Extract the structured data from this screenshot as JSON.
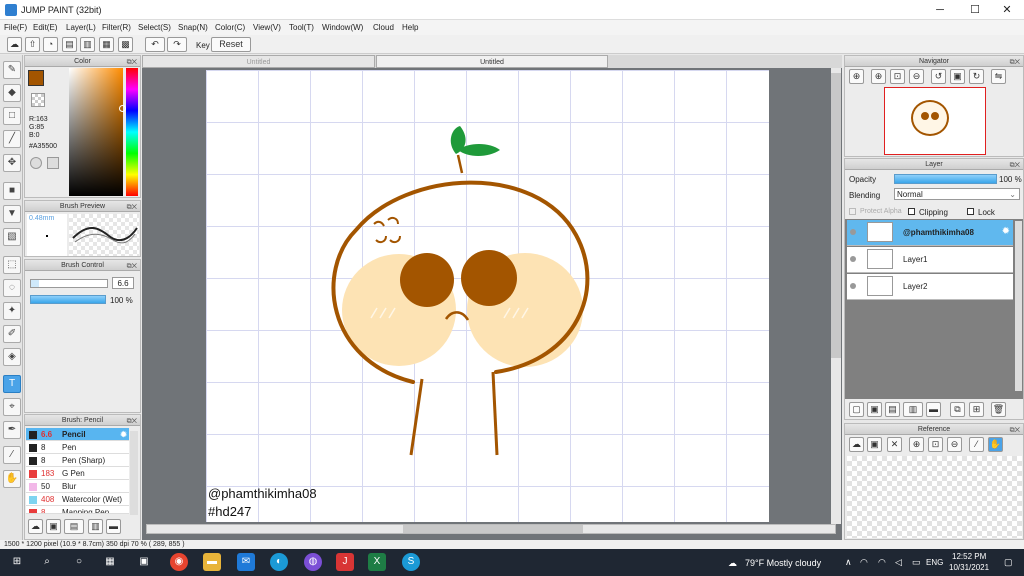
{
  "window": {
    "title": "JUMP PAINT (32bit)"
  },
  "menu": [
    "File(F)",
    "Edit(E)",
    "Layer(L)",
    "Filter(R)",
    "Select(S)",
    "Snap(N)",
    "Color(C)",
    "View(V)",
    "Tool(T)",
    "Window(W)",
    "Cloud",
    "Help"
  ],
  "toolbar": {
    "key_label": "Key",
    "reset_label": "Reset"
  },
  "color_panel": {
    "title": "Color",
    "r": "R:163",
    "g": "G:85",
    "b": "B:0",
    "hex": "#A35500",
    "main_color": "#A35500"
  },
  "brush_preview": {
    "title": "Brush Preview",
    "size": "0.48mm"
  },
  "brush_control": {
    "title": "Brush Control",
    "size_value": "6.6",
    "opacity_value": "100 %"
  },
  "brush_list": {
    "title": "Brush: Pencil",
    "items": [
      {
        "size": "6.6",
        "name": "Pencil",
        "color": "#222222"
      },
      {
        "size": "8",
        "name": "Pen",
        "color": "#222222"
      },
      {
        "size": "8",
        "name": "Pen (Sharp)",
        "color": "#222222"
      },
      {
        "size": "183",
        "name": "G Pen",
        "color": "#e83c3c"
      },
      {
        "size": "50",
        "name": "Blur",
        "color": "#f2b8e8"
      },
      {
        "size": "408",
        "name": "Watercolor (Wet)",
        "color": "#7ed4f0"
      },
      {
        "size": "8",
        "name": "Mapping Pen",
        "color": "#e83c3c"
      }
    ]
  },
  "tabs": [
    "Untitled",
    "Untitled"
  ],
  "canvas": {
    "watermark_line1": "@phamthikimha08",
    "watermark_line2": "#hd247"
  },
  "navigator": {
    "title": "Navigator"
  },
  "layer_panel": {
    "title": "Layer",
    "opacity_label": "Opacity",
    "opacity_value": "100 %",
    "blending_label": "Blending",
    "blending_value": "Normal",
    "protect_alpha": "Protect Alpha",
    "clipping": "Clipping",
    "lock": "Lock",
    "layers": [
      "@phamthikimha08",
      "Layer1",
      "Layer2"
    ]
  },
  "reference": {
    "title": "Reference"
  },
  "status": {
    "text": "1500 * 1200 pixel   (10.9 * 8.7cm)   350 dpi   70 %   ( 289, 855 )"
  },
  "taskbar": {
    "weather": "79°F  Mostly cloudy",
    "lang": "ENG",
    "time": "12:52 PM",
    "date": "10/31/2021"
  }
}
